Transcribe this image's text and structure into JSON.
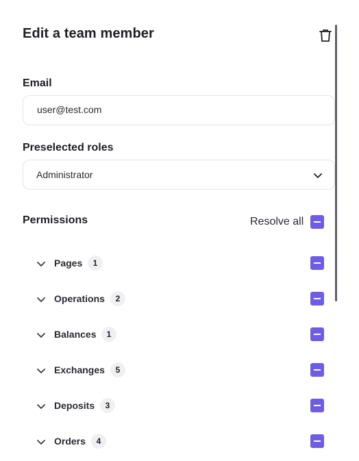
{
  "header": {
    "title": "Edit a team member",
    "delete_icon": "trash-icon"
  },
  "email": {
    "label": "Email",
    "value": "user@test.com"
  },
  "roles": {
    "label": "Preselected roles",
    "value": "Administrator",
    "icon": "chevron-down-icon"
  },
  "permissions": {
    "label": "Permissions",
    "resolve_all_label": "Resolve all",
    "accent_color": "#6e5ce6",
    "groups": [
      {
        "name": "Pages",
        "count": "1"
      },
      {
        "name": "Operations",
        "count": "2"
      },
      {
        "name": "Balances",
        "count": "1"
      },
      {
        "name": "Exchanges",
        "count": "5"
      },
      {
        "name": "Deposits",
        "count": "3"
      },
      {
        "name": "Orders",
        "count": "4"
      }
    ]
  }
}
